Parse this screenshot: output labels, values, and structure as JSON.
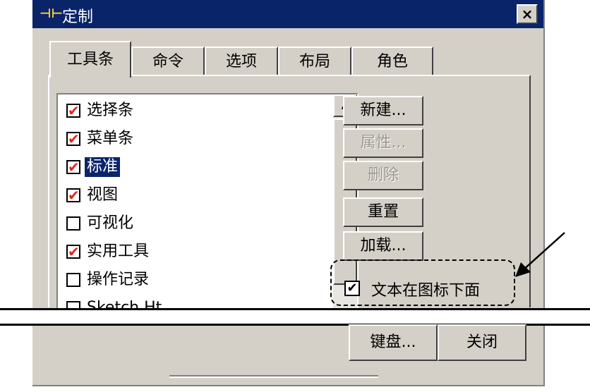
{
  "window": {
    "title": "定制",
    "close_label": "×"
  },
  "tabs": [
    {
      "label": "工具条",
      "active": true
    },
    {
      "label": "命令",
      "active": false
    },
    {
      "label": "选项",
      "active": false
    },
    {
      "label": "布局",
      "active": false
    },
    {
      "label": "角色",
      "active": false
    }
  ],
  "toolbars_list": [
    {
      "label": "选择条",
      "checked": true,
      "selected": false
    },
    {
      "label": "菜单条",
      "checked": true,
      "selected": false
    },
    {
      "label": "标准",
      "checked": true,
      "selected": true
    },
    {
      "label": "视图",
      "checked": true,
      "selected": false
    },
    {
      "label": "可视化",
      "checked": false,
      "selected": false
    },
    {
      "label": "实用工具",
      "checked": true,
      "selected": false
    },
    {
      "label": "操作记录",
      "checked": false,
      "selected": false
    },
    {
      "label": "Sketch Ht",
      "checked": false,
      "selected": false
    }
  ],
  "buttons": {
    "new": "新建...",
    "properties": "属性...",
    "delete": "删除",
    "reset": "重置",
    "load": "加载...",
    "keyboard": "键盘...",
    "close": "关闭"
  },
  "text_under_icon": {
    "label": "文本在图标下面",
    "checked": true
  },
  "colors": {
    "titlebar": "#0a246a",
    "check_mark": "#e0251b",
    "face": "#d4d0c8"
  }
}
